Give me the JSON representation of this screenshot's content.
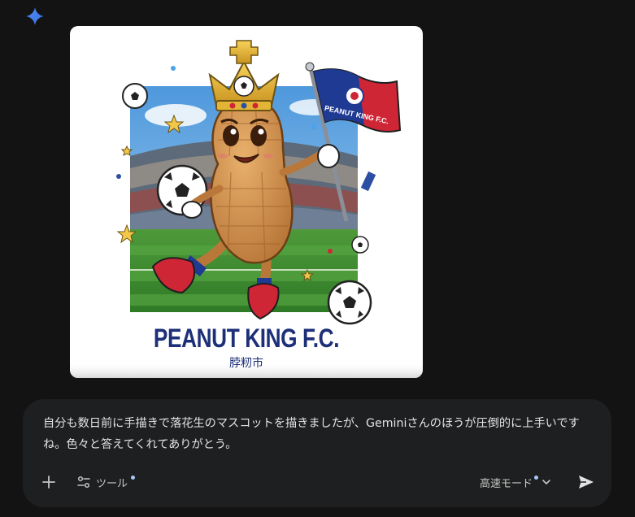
{
  "generated_image": {
    "title": "PEANUT KING F.C.",
    "subtitle": "脖籾市",
    "flag_text": "PEANUT KING F.C."
  },
  "prompt": {
    "text": "自分も数日前に手描きで落花生のマスコットを描きましたが、Geminiさんのほうが圧倒的に上手いですね。色々と答えてくれてありがとう。"
  },
  "toolbar": {
    "tools_label": "ツール",
    "mode_label": "高速モード"
  },
  "icons": {
    "spark": "gemini-spark-icon",
    "plus": "plus-icon",
    "tools": "sliders-icon",
    "chevron": "chevron-down-icon",
    "send": "send-icon"
  },
  "colors": {
    "background": "#131314",
    "panel": "#1e1f20",
    "accent": "#4285f4",
    "dot": "#a8c7fa",
    "text": "#e3e3e3"
  }
}
